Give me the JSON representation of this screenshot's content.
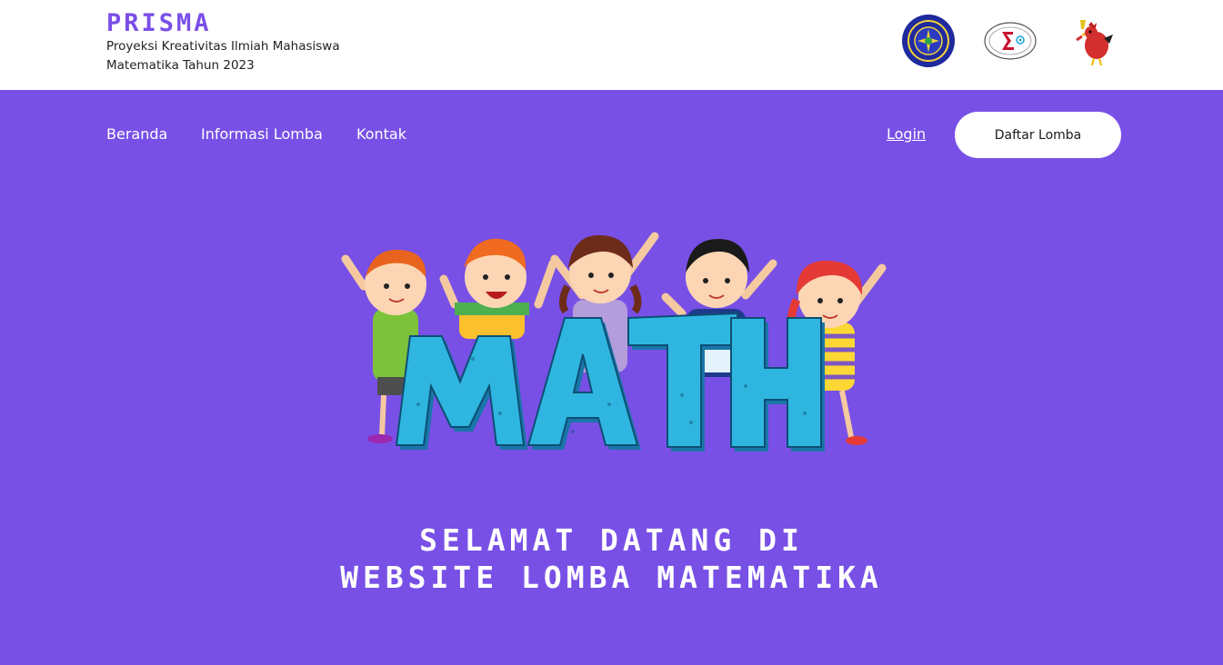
{
  "brand": {
    "title": "PRISMA",
    "subtitle_line1": "Proyeksi Kreativitas Ilmiah Mahasiswa",
    "subtitle_line2": "Matematika Tahun 2023"
  },
  "header_logos": [
    {
      "icon": "university-seal-icon"
    },
    {
      "icon": "sigma-association-icon"
    },
    {
      "icon": "rooster-mascot-icon"
    }
  ],
  "nav": {
    "home": "Beranda",
    "info": "Informasi Lomba",
    "contact": "Kontak",
    "login": "Login",
    "register": "Daftar Lomba"
  },
  "hero": {
    "math_word": "MATH"
  },
  "welcome": {
    "line1": "SELAMAT DATANG DI",
    "line2": "WEBSITE LOMBA MATEMATIKA"
  },
  "colors": {
    "background": "#7850e6",
    "brand_purple": "#7a4fe8",
    "math_blue": "#2fb6e0",
    "white": "#ffffff"
  }
}
